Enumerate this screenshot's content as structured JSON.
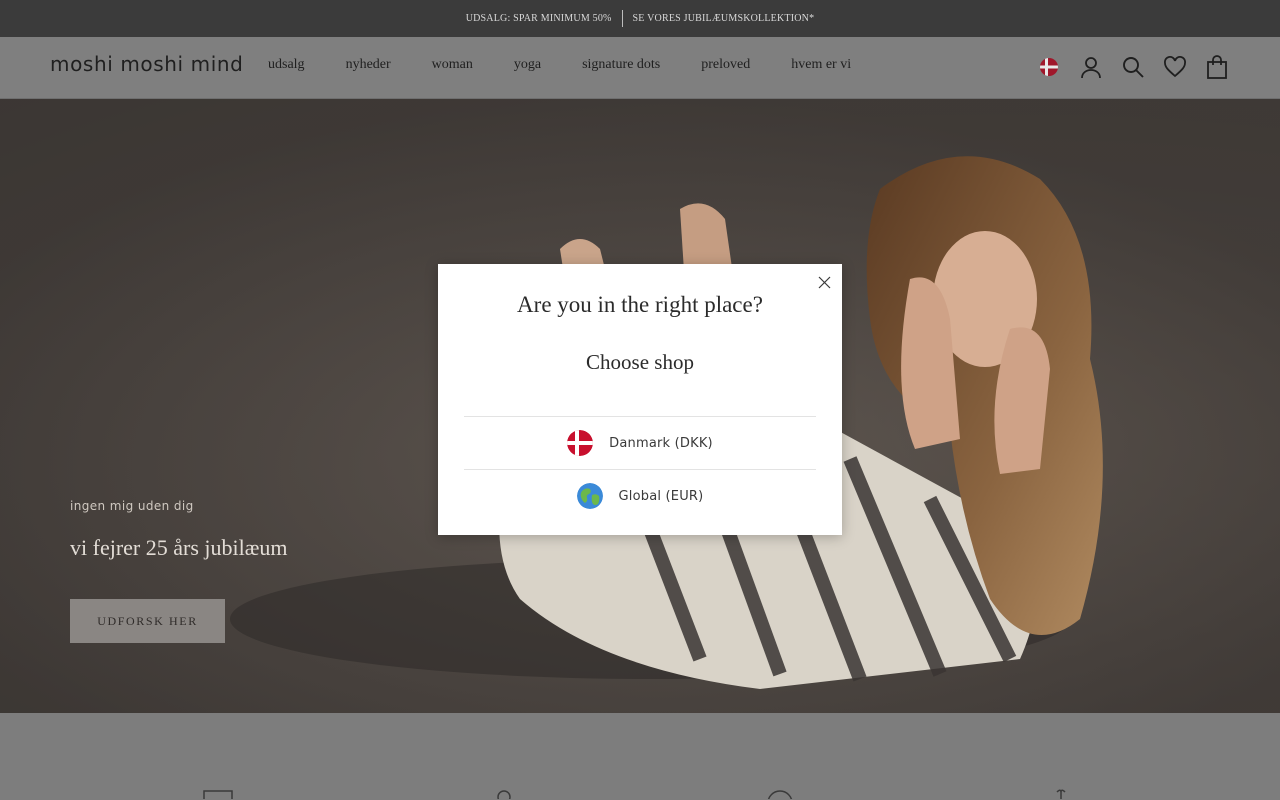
{
  "announcement": {
    "left": "UDSALG: SPAR MINIMUM 50%",
    "right": "SE VORES JUBILÆUMSKOLLEKTION*"
  },
  "header": {
    "logo": "moshi moshi mind",
    "nav": [
      "udsalg",
      "nyheder",
      "woman",
      "yoga",
      "signature dots",
      "preloved",
      "hvem er vi"
    ],
    "icons": [
      "denmark-flag-icon",
      "account-icon",
      "search-icon",
      "wishlist-heart-icon",
      "cart-bag-icon"
    ]
  },
  "hero": {
    "subtitle": "ingen mig uden dig",
    "title": "vi fejrer 25 års jubilæum",
    "cta": "UDFORSK HER"
  },
  "modal": {
    "title": "Are you in the right place?",
    "subtitle": "Choose shop",
    "options": [
      {
        "label": "Danmark (DKK)",
        "icon": "denmark-flag-icon"
      },
      {
        "label": "Global (EUR)",
        "icon": "globe-icon"
      }
    ]
  },
  "colors": {
    "announcement_bg": "#3b3b3b",
    "header_bg_dimmed": "#7f7f7f",
    "modal_bg": "#ffffff",
    "danish_red": "#c8102e"
  }
}
